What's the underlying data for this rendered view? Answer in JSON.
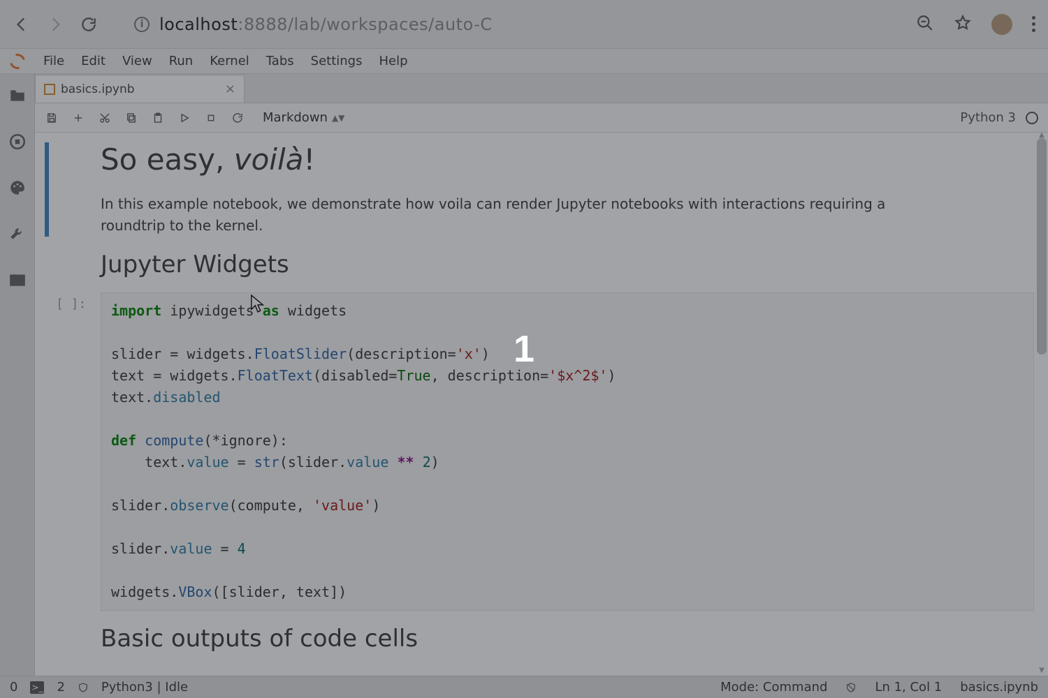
{
  "browser": {
    "url_host": "localhost",
    "url_rest": ":8888/lab/workspaces/auto-C"
  },
  "menu": {
    "items": [
      "File",
      "Edit",
      "View",
      "Run",
      "Kernel",
      "Tabs",
      "Settings",
      "Help"
    ]
  },
  "tab": {
    "title": "basics.ipynb",
    "close": "×"
  },
  "toolbar": {
    "celltype": "Markdown",
    "kernel": "Python 3"
  },
  "cells": {
    "md1_title_a": "So easy, ",
    "md1_title_em": "voilà",
    "md1_title_b": "!",
    "md1_para": "In this example notebook, we demonstrate how voila can render Jupyter notebooks with interactions requiring a roundtrip to the kernel.",
    "md2_title": "Jupyter Widgets",
    "code_prompt": "[ ]:",
    "md3_title": "Basic outputs of code cells"
  },
  "status": {
    "tabs_open": "0",
    "terminals": "2",
    "kernel": "Python3 | Idle",
    "mode": "Mode: Command",
    "pos": "Ln 1, Col 1",
    "file": "basics.ipynb"
  },
  "overlay_number": "1",
  "site_info_char": "i"
}
